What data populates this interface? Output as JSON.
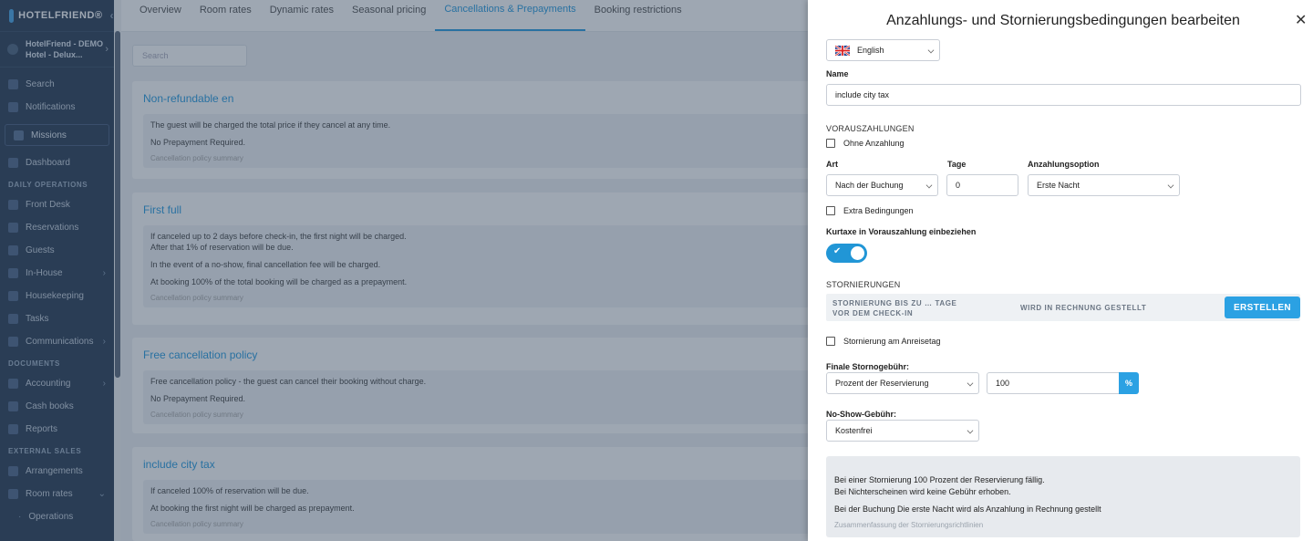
{
  "sidebar": {
    "brand": "HOTELFRIEND®",
    "hotel_line1": "HotelFriend - DEMO",
    "hotel_line2": "Hotel - Delux...",
    "search": "Search",
    "notifications": "Notifications",
    "missions": "Missions",
    "dashboard": "Dashboard",
    "sec_daily": "DAILY OPERATIONS",
    "front_desk": "Front Desk",
    "reservations": "Reservations",
    "guests": "Guests",
    "in_house": "In-House",
    "housekeeping": "Housekeeping",
    "tasks": "Tasks",
    "communications": "Communications",
    "sec_documents": "DOCUMENTS",
    "accounting": "Accounting",
    "cash_books": "Cash books",
    "reports": "Reports",
    "sec_external": "EXTERNAL SALES",
    "arrangements": "Arrangements",
    "room_rates": "Room rates",
    "operations": "Operations"
  },
  "tabs": [
    "Overview",
    "Room rates",
    "Dynamic rates",
    "Seasonal pricing",
    "Cancellations & Prepayments",
    "Booking restrictions"
  ],
  "main": {
    "search_placeholder": "Search",
    "cards": [
      {
        "title": "Non-refundable en",
        "lines": [
          "The guest will be charged the total price if they cancel at any time.",
          "No Prepayment Required."
        ],
        "summary": "Cancellation policy summary"
      },
      {
        "title": "First full",
        "lines": [
          "If canceled up to 2 days before check-in, the first night will be charged. After that 1% of reservation will be due.",
          "In the event of a no-show, final cancellation fee will be charged.",
          "At booking 100% of the total booking will be charged as a prepayment."
        ],
        "summary": "Cancellation policy summary"
      },
      {
        "title": "Free cancellation policy",
        "lines": [
          "Free cancellation policy - the guest can cancel their booking without charge.",
          "No Prepayment Required."
        ],
        "summary": "Cancellation policy summary"
      },
      {
        "title": "include city tax",
        "lines": [
          "If canceled 100% of reservation will be due.",
          "At booking the first night will be charged as prepayment."
        ],
        "summary": "Cancellation policy summary"
      }
    ]
  },
  "drawer": {
    "title": "Anzahlungs- und Stornierungsbedingungen bearbeiten",
    "close": "✕",
    "language": "English",
    "name_label": "Name",
    "name_value": "include city tax",
    "prepay_section": "VORAUSZAHLUNGEN",
    "no_deposit": "Ohne Anzahlung",
    "art_label": "Art",
    "art_value": "Nach der Buchung",
    "tage_label": "Tage",
    "tage_value": "0",
    "option_label": "Anzahlungsoption",
    "option_value": "Erste Nacht",
    "extra": "Extra Bedingungen",
    "citytax_label": "Kurtaxe in Vorauszahlung einbeziehen",
    "citytax_on": true,
    "cancel_section": "STORNIERUNGEN",
    "col1_line1": "STORNIERUNG BIS ZU … TAGE",
    "col1_line2": "VOR DEM CHECK-IN",
    "col2": "WIRD IN RECHNUNG GESTELLT",
    "create_button": "ERSTELLEN",
    "arrival_day": "Stornierung am Anreisetag",
    "final_fee_label": "Finale Stornogebühr:",
    "final_fee_type": "Prozent der Reservierung",
    "final_fee_value": "100",
    "final_fee_unit": "%",
    "noshow_label": "No-Show-Gebühr:",
    "noshow_value": "Kostenfrei",
    "summary_line1": "Bei einer Stornierung 100 Prozent der Reservierung fällig.",
    "summary_line2": "Bei Nichterscheinen wird keine Gebühr erhoben.",
    "summary_line3": "Bei der Buchung Die erste Nacht wird als Anzahlung in Rechnung gestellt",
    "summary_footer": "Zusammenfassung der Stornierungsrichtlinien"
  },
  "colors": {
    "accent": "#2ba1e3",
    "sidebar_bg": "#2c3e57",
    "overlay": "rgba(40,60,85,0.45)"
  }
}
